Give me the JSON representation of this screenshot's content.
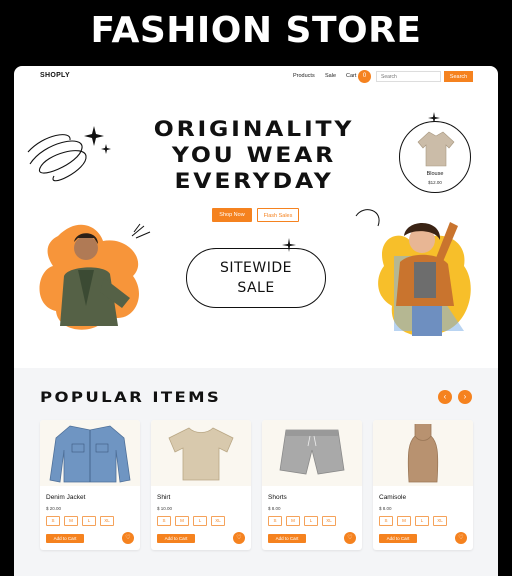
{
  "banner": {
    "title": "FASHION STORE"
  },
  "nav": {
    "logo": "SHOPLY",
    "links": [
      "Products",
      "Sale",
      "Cart"
    ],
    "cart_count": "0",
    "search_placeholder": "Search",
    "search_button": "Search"
  },
  "hero": {
    "lines": [
      "ORIGINALITY",
      "YOU WEAR",
      "EVERYDAY"
    ],
    "cta_primary": "Shop Now",
    "cta_secondary": "Flash Sales",
    "sale_line1": "SITEWIDE",
    "sale_line2": "SALE",
    "featured": {
      "name": "Blouse",
      "price": "$12.00"
    }
  },
  "popular": {
    "title": "POPULAR ITEMS",
    "prev_icon": "‹",
    "next_icon": "›",
    "add_label": "Add to Cart",
    "sizes": [
      "S",
      "M",
      "L",
      "XL"
    ],
    "items": [
      {
        "name": "Denim Jacket",
        "price": "$ 20.00"
      },
      {
        "name": "Shirt",
        "price": "$ 10.00"
      },
      {
        "name": "Shorts",
        "price": "$ 8.00"
      },
      {
        "name": "Camisole",
        "price": "$ 8.00"
      }
    ]
  },
  "colors": {
    "accent": "#f5821f",
    "frame": "#ffffff",
    "section_bg": "#f4f5f7"
  }
}
